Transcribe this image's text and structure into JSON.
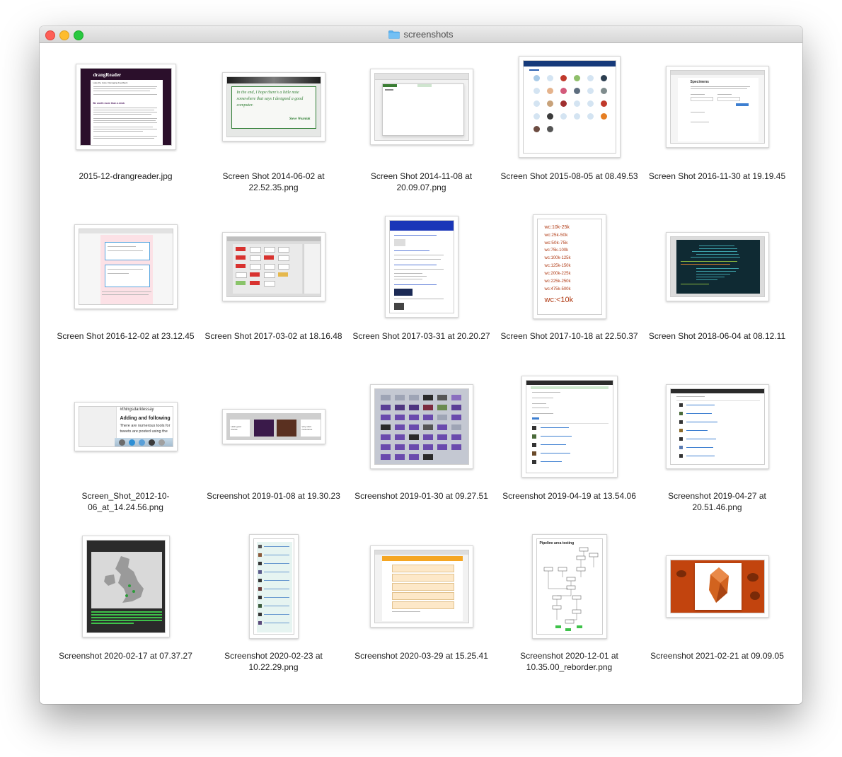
{
  "window": {
    "title": "screenshots",
    "icon": "folder-icon"
  },
  "files": [
    {
      "name": "2015-12-drangreader.jpg"
    },
    {
      "name": "Screen Shot 2014-06-02 at 22.52.35.png"
    },
    {
      "name": "Screen Shot 2014-11-08 at 20.09.07.png"
    },
    {
      "name": "Screen Shot 2015-08-05 at 08.49.53"
    },
    {
      "name": "Screen Shot 2016-11-30 at 19.19.45"
    },
    {
      "name": "Screen Shot 2016-12-02 at 23.12.45"
    },
    {
      "name": "Screen Shot 2017-03-02 at 18.16.48"
    },
    {
      "name": "Screen Shot 2017-03-31 at 20.20.27"
    },
    {
      "name": "Screen Shot 2017-10-18 at 22.50.37"
    },
    {
      "name": "Screen Shot 2018-06-04 at 08.12.11"
    },
    {
      "name": "Screen_Shot_2012-10-06_at_14.24.56.png"
    },
    {
      "name": "Screenshot 2019-01-08 at 19.30.23"
    },
    {
      "name": "Screenshot 2019-01-30 at 09.27.51"
    },
    {
      "name": "Screenshot 2019-04-19 at 13.54.06"
    },
    {
      "name": "Screenshot 2019-04-27 at 20.51.46.png"
    },
    {
      "name": "Screenshot 2020-02-17 at 07.37.27"
    },
    {
      "name": "Screenshot 2020-02-23 at 10.22.29.png"
    },
    {
      "name": "Screenshot 2020-03-29 at 15.25.41"
    },
    {
      "name": "Screenshot 2020-12-01 at 10.35.00_reborder.png"
    },
    {
      "name": "Screenshot 2021-02-21 at 09.09.05"
    }
  ],
  "thumbnail_text": {
    "drangreader": {
      "heading": "drangReader",
      "subheading": "Lake the Juice: Damaging Feedback",
      "section": "Be worth more than a desk"
    },
    "quote": {
      "text": "In the end, I hope there's a little note somewhere that says I designed a good computer.",
      "author": "Steve Wozniak"
    },
    "specimens": {
      "title": "Specimens"
    },
    "wordcount": {
      "tags": [
        "wc:10k-25k",
        "wc:25k-50k",
        "wc:50k-75k",
        "wc:75k-100k",
        "wc:100k-125k",
        "wc:125k-150k",
        "wc:200k-225k",
        "wc:225k-250k",
        "wc:475k-500k"
      ],
      "big_tag": "wc:<10k"
    },
    "tweet": {
      "hashtag": "#thingsdarklessay",
      "heading": "Adding and following",
      "line1": "There are numerous tools for",
      "line2": "tweets are posted using the"
    },
    "slides": {
      "left": "Hello good friends",
      "right": "Very short conference"
    },
    "pipeline": {
      "title": "Pipeline area testing"
    }
  }
}
